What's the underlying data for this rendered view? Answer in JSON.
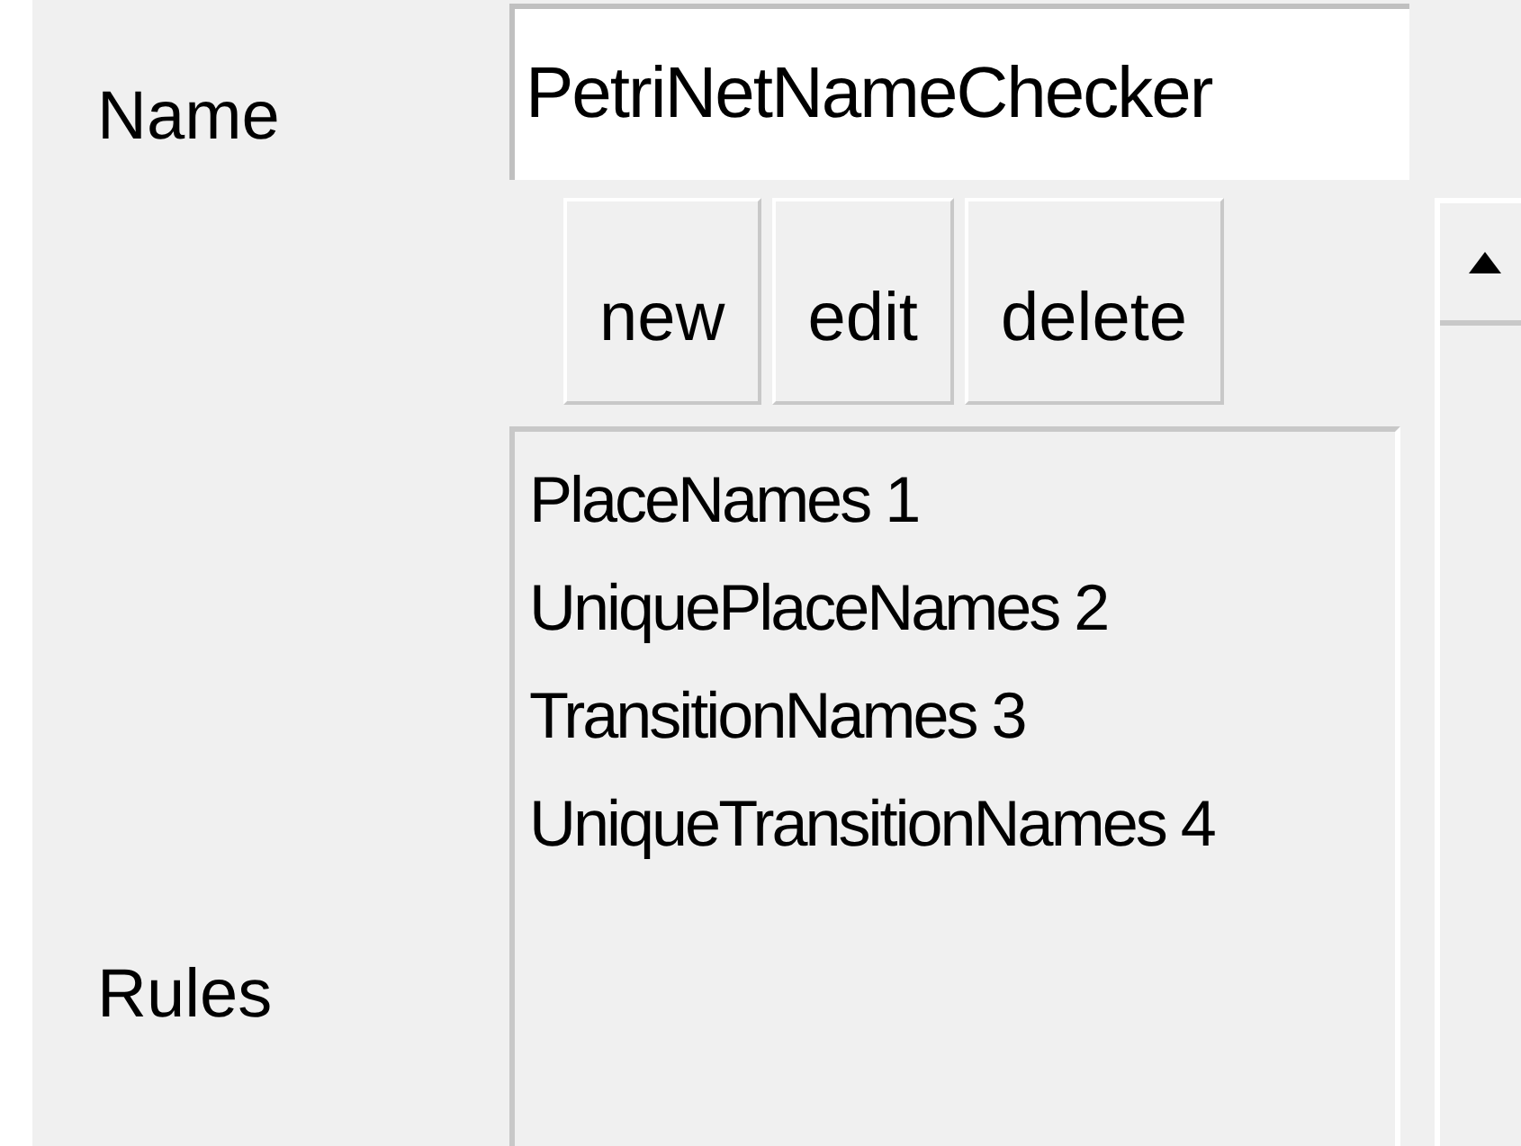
{
  "name_field": {
    "label": "Name",
    "value": "PetriNetNameChecker"
  },
  "buttons": [
    "new",
    "edit",
    "delete"
  ],
  "rules": {
    "label": "Rules",
    "items": [
      "PlaceNames 1",
      "UniquePlaceNames 2",
      "TransitionNames 3",
      "UniqueTransitionNames 4"
    ]
  }
}
